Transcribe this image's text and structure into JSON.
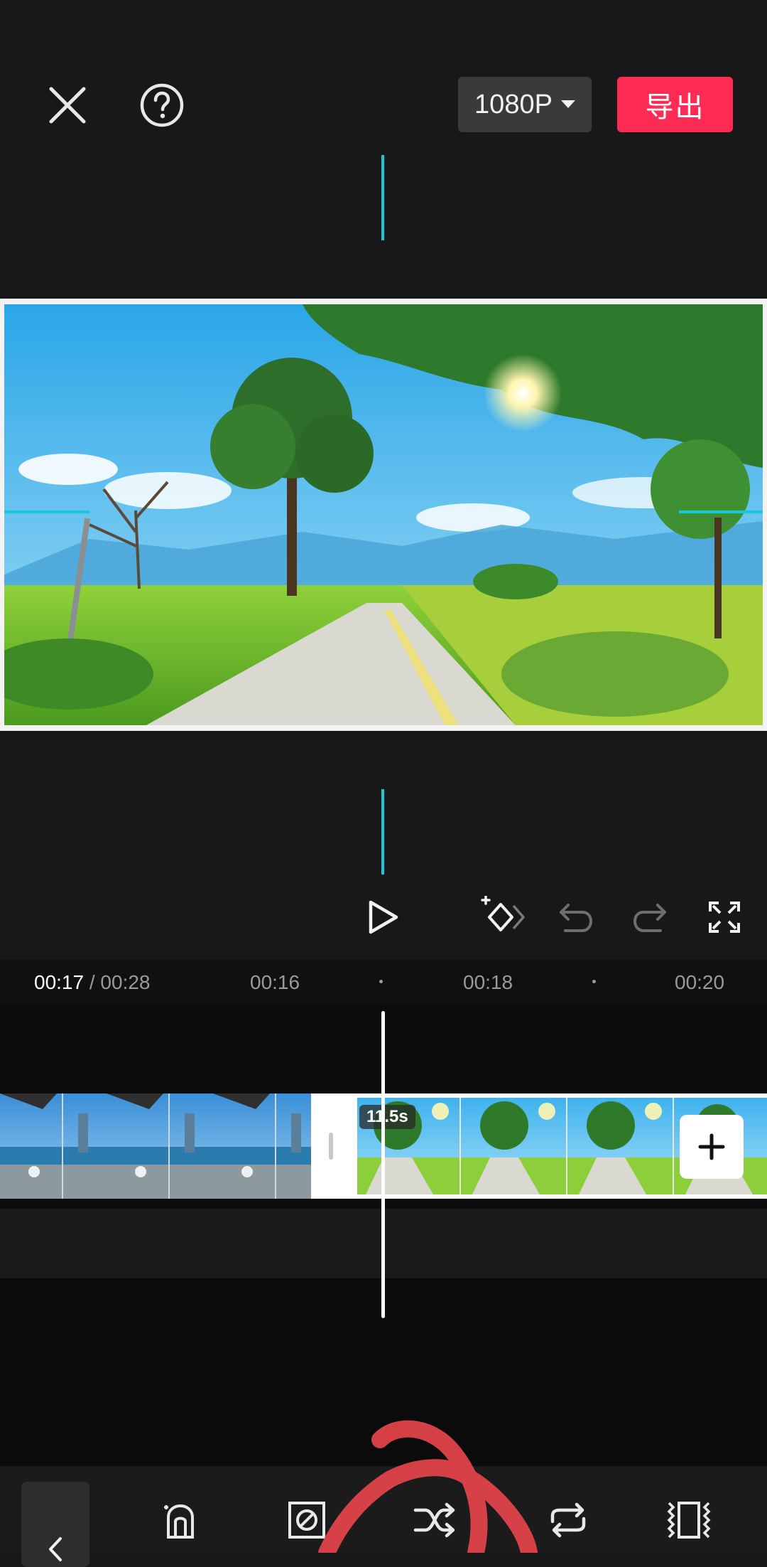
{
  "header": {
    "resolution_label": "1080P",
    "export_label": "导出"
  },
  "timeline": {
    "current_time": "00:17",
    "separator": " / ",
    "total_time": "00:28",
    "ticks": [
      "00:16",
      "00:18",
      "00:20"
    ],
    "clip_duration": "11.5s"
  },
  "colors": {
    "export_accent": "#fe2c55",
    "guide_cyan": "#19c8d8",
    "annotation_red": "#e0434a"
  },
  "icons": {
    "close": "close-icon",
    "help": "help-icon",
    "play": "play-icon",
    "keyframe": "keyframe-add-icon",
    "undo": "undo-icon",
    "redo": "redo-icon",
    "fullscreen": "fullscreen-icon",
    "add_clip": "plus-icon"
  }
}
